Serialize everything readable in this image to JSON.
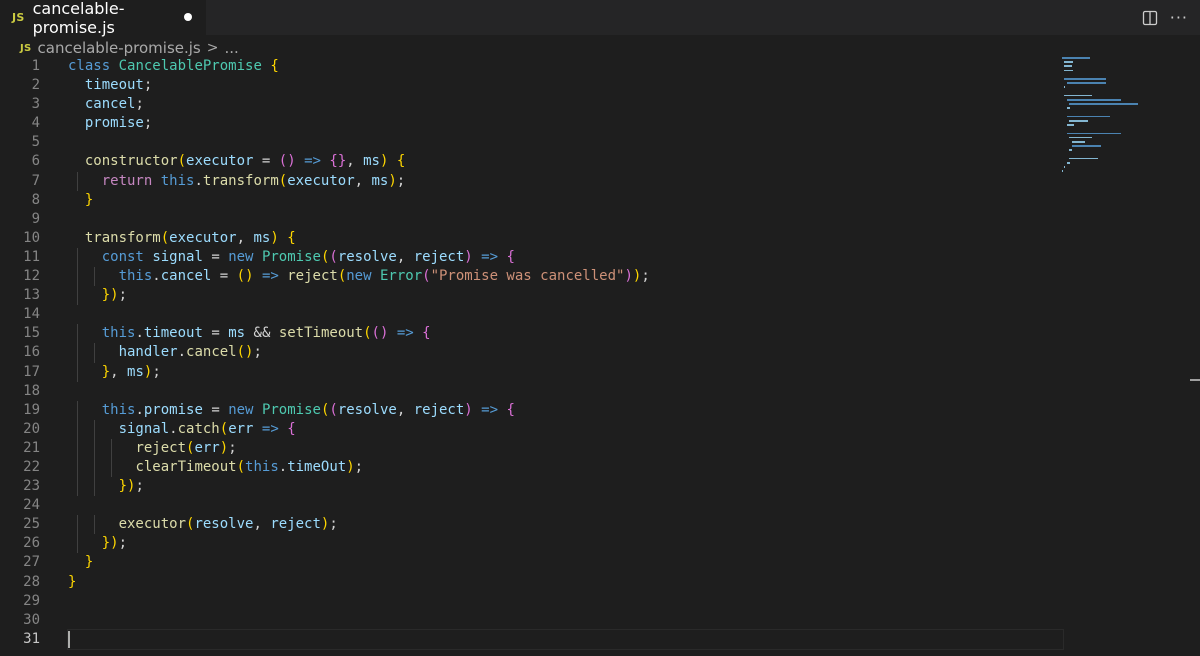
{
  "tab": {
    "badge": "JS",
    "title": "cancelable-promise.js"
  },
  "breadcrumb": {
    "badge": "JS",
    "file": "cancelable-promise.js",
    "separator": ">",
    "more": "..."
  },
  "actions": {
    "more": "···"
  },
  "editor": {
    "active_line": 31,
    "line_numbers": [
      "1",
      "2",
      "3",
      "4",
      "5",
      "6",
      "7",
      "8",
      "9",
      "10",
      "11",
      "12",
      "13",
      "14",
      "15",
      "16",
      "17",
      "18",
      "19",
      "20",
      "21",
      "22",
      "23",
      "24",
      "25",
      "26",
      "27",
      "28",
      "29",
      "30",
      "31"
    ],
    "lines": [
      "class CancelablePromise {",
      "  timeout;",
      "  cancel;",
      "  promise;",
      "",
      "  constructor(executor = () => {}, ms) {",
      "    return this.transform(executor, ms);",
      "  }",
      "",
      "  transform(executor, ms) {",
      "    const signal = new Promise((resolve, reject) => {",
      "      this.cancel = () => reject(new Error(\"Promise was cancelled\"));",
      "    });",
      "",
      "    this.timeout = ms && setTimeout(() => {",
      "      handler.cancel();",
      "    }, ms);",
      "",
      "    this.promise = new Promise((resolve, reject) => {",
      "      signal.catch(err => {",
      "        reject(err);",
      "        clearTimeout(this.timeOut);",
      "      });",
      "",
      "      executor(resolve, reject);",
      "    });",
      "  }",
      "}",
      "",
      "",
      ""
    ]
  },
  "colors": {
    "background": "#1e1e1e",
    "tabbar": "#252526",
    "keyword": "#569cd6",
    "control": "#c586c0",
    "class": "#4ec9b0",
    "function": "#dcdcaa",
    "variable": "#9cdcfe",
    "string": "#ce9178"
  }
}
